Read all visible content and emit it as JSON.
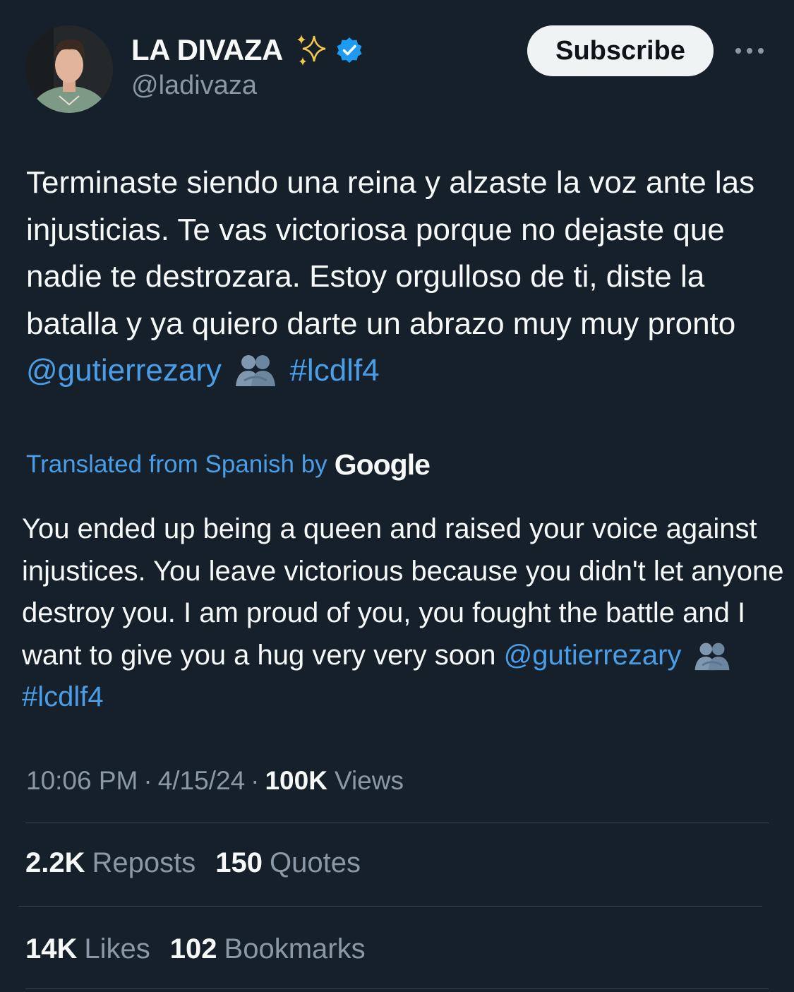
{
  "author": {
    "display_name": "LA DIVAZA",
    "handle": "@ladivaza",
    "verified": true,
    "avatar_icon": "avatar-photo",
    "name_emoji": "sparkles-icon"
  },
  "header": {
    "subscribe_label": "Subscribe",
    "more_icon": "ellipsis-icon"
  },
  "tweet": {
    "text_before_mention": "Terminaste siendo una reina y alzaste la voz ante las injusticias. Te vas victoriosa porque no dejaste que nadie te destrozara. Estoy orgulloso de ti, diste la batalla y ya quiero darte un abrazo muy muy pronto ",
    "mention": "@gutierrezary",
    "emoji": "people-hugging-icon",
    "hashtag": "#lcdlf4"
  },
  "translation": {
    "label": "Translated from Spanish by",
    "provider": "Google",
    "text_before_mention": "You ended up being a queen and raised your voice against injustices. You leave victorious because you didn't let anyone destroy you. I am proud of you, you fought the battle and I want to give you a hug very very soon ",
    "mention": "@gutierrezary",
    "hashtag": "#lcdlf4"
  },
  "meta": {
    "time": "10:06 PM",
    "date": "4/15/24",
    "views_count": "100K",
    "views_label": "Views"
  },
  "stats": {
    "reposts_count": "2.2K",
    "reposts_label": "Reposts",
    "quotes_count": "150",
    "quotes_label": "Quotes",
    "likes_count": "14K",
    "likes_label": "Likes",
    "bookmarks_count": "102",
    "bookmarks_label": "Bookmarks"
  },
  "colors": {
    "background": "#15202b",
    "link": "#4a9ee8",
    "muted": "#8b98a5",
    "verified": "#1d9bf0"
  }
}
